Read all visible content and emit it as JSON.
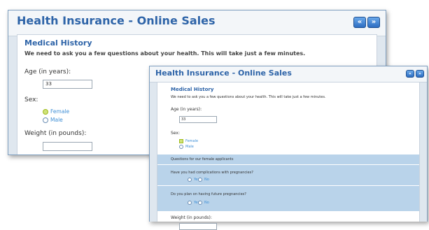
{
  "window_back": {
    "title": "Health Insurance - Online Sales",
    "nav_prev": "«",
    "nav_next": "»",
    "section_title": "Medical History",
    "intro": "We need to ask you a few questions about your health. This will take just a few minutes.",
    "age_label": "Age (in years):",
    "age_value": "33",
    "sex_label": "Sex:",
    "sex_options": [
      "Female",
      "Male"
    ],
    "weight_label": "Weight (in pounds):",
    "weight_value": ""
  },
  "window_front": {
    "title": "Health Insurance - Online Sales",
    "nav_prev": "«",
    "nav_next": "»",
    "section_title": "Medical History",
    "intro": "We need to ask you a few questions about your health. This will take just a few minutes.",
    "age_label": "Age (in years):",
    "age_value": "33",
    "sex_label": "Sex:",
    "sex_options": [
      "Female",
      "Male"
    ],
    "female_section_title": "Questions for our female applicants",
    "q1": "Have you had complications with pregnancies?",
    "q1_options": [
      "Yes",
      "No"
    ],
    "q2": "Do you plan on having future pregnancies?",
    "q2_options": [
      "Yes",
      "No"
    ],
    "weight_label": "Weight (in pounds):"
  },
  "colors": {
    "title_blue": "#2e64a8",
    "option_blue": "#3f8fd6",
    "highlight_band": "#b9d3ea",
    "selected_radio": "#9fbb1c"
  }
}
